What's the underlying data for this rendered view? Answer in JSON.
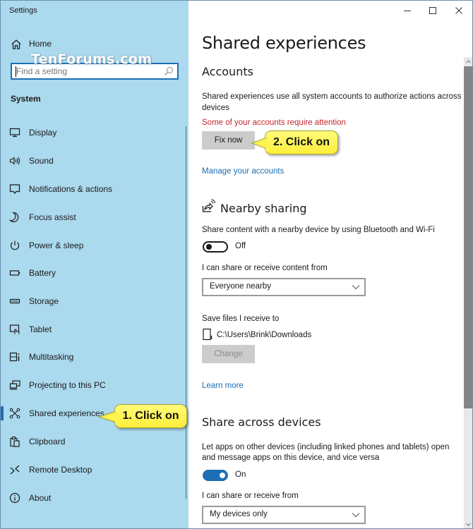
{
  "window": {
    "app_title": "Settings",
    "controls": {
      "minimize": "minimize-icon",
      "maximize": "maximize-icon",
      "close": "close-icon"
    },
    "border_color": "#6b8fae"
  },
  "watermark": "TenForums.com",
  "sidebar": {
    "background": "#abd9ed",
    "home": {
      "label": "Home",
      "icon": "home-icon"
    },
    "search": {
      "placeholder": "Find a setting",
      "value": "",
      "icon": "search-icon"
    },
    "section": "System",
    "selected_index": 10,
    "items": [
      {
        "label": "Display",
        "icon": "display-icon"
      },
      {
        "label": "Sound",
        "icon": "sound-icon"
      },
      {
        "label": "Notifications & actions",
        "icon": "notifications-icon"
      },
      {
        "label": "Focus assist",
        "icon": "moon-icon"
      },
      {
        "label": "Power & sleep",
        "icon": "power-icon"
      },
      {
        "label": "Battery",
        "icon": "battery-icon"
      },
      {
        "label": "Storage",
        "icon": "storage-icon"
      },
      {
        "label": "Tablet",
        "icon": "tablet-icon"
      },
      {
        "label": "Multitasking",
        "icon": "multitasking-icon"
      },
      {
        "label": "Projecting to this PC",
        "icon": "projecting-icon"
      },
      {
        "label": "Shared experiences",
        "icon": "shared-experiences-icon"
      },
      {
        "label": "Clipboard",
        "icon": "clipboard-icon"
      },
      {
        "label": "Remote Desktop",
        "icon": "remote-desktop-icon"
      },
      {
        "label": "About",
        "icon": "info-icon"
      }
    ]
  },
  "main": {
    "title": "Shared experiences",
    "accounts": {
      "heading": "Accounts",
      "description": "Shared experiences use all system accounts to authorize actions across devices",
      "warning": "Some of your accounts require attention",
      "fix_button": "Fix now",
      "manage_link": "Manage your accounts"
    },
    "nearby_sharing": {
      "heading": "Nearby sharing",
      "icon": "nearby-sharing-icon",
      "description": "Share content with a nearby device by using Bluetooth and Wi-Fi",
      "toggle_state": "Off",
      "toggle_on": false,
      "share_from_label": "I can share or receive content from",
      "share_from_value": "Everyone nearby",
      "save_label": "Save files I receive to",
      "save_path": "C:\\Users\\Brink\\Downloads",
      "change_button": "Change",
      "learn_more": "Learn more"
    },
    "share_across": {
      "heading": "Share across devices",
      "description_line1": "Let apps on other devices (including linked phones and tablets) open",
      "description_line2": "and message apps on this device, and vice versa",
      "toggle_state": "On",
      "toggle_on": true,
      "share_from_label": "I can share or receive from",
      "share_from_value": "My devices only"
    }
  },
  "callouts": [
    {
      "text": "1. Click on",
      "target": "Shared experiences"
    },
    {
      "text": "2. Click on",
      "target": "Fix now"
    }
  ],
  "colors": {
    "accent": "#1e6fb5",
    "warning": "#c4262e",
    "link": "#1a6fb5",
    "callout": "#fff34d",
    "button": "#cccccc"
  }
}
